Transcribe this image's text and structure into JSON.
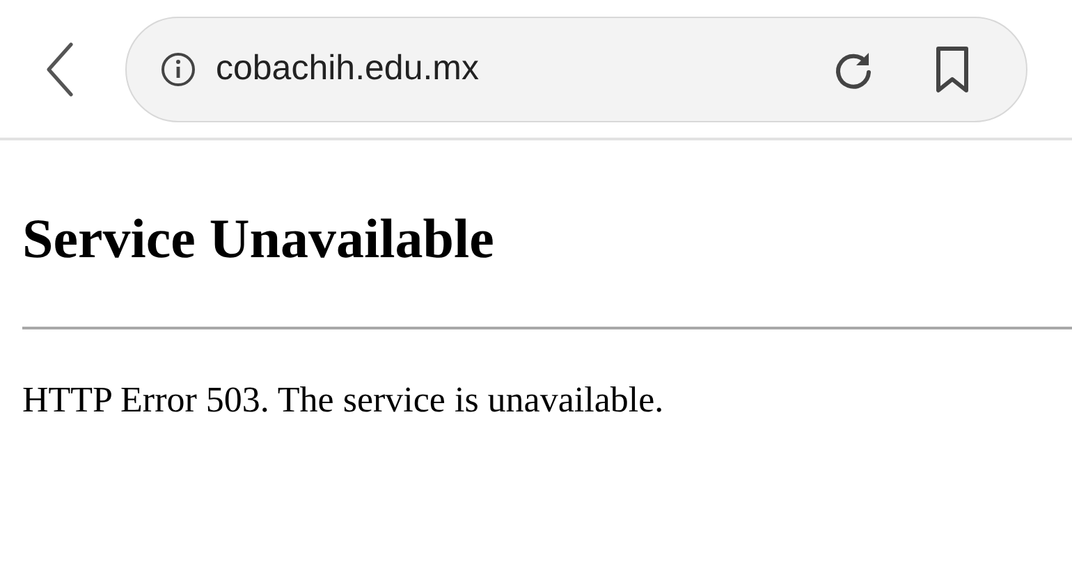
{
  "browser": {
    "url": "cobachih.edu.mx"
  },
  "page": {
    "heading": "Service Unavailable",
    "message": "HTTP Error 503. The service is unavailable."
  }
}
